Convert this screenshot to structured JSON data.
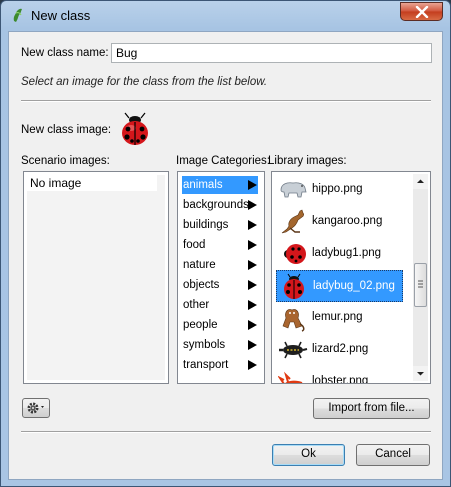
{
  "window": {
    "title": "New class"
  },
  "form": {
    "class_name_label": "New class name:",
    "class_name_value": "Bug",
    "hint": "Select an image for the class from the list below.",
    "class_image_label": "New class image:"
  },
  "scenario": {
    "label": "Scenario images:",
    "items": [
      "No image"
    ]
  },
  "categories": {
    "label": "Image Categories:",
    "selected": "animals",
    "items": [
      "animals",
      "backgrounds",
      "buildings",
      "food",
      "nature",
      "objects",
      "other",
      "people",
      "symbols",
      "transport"
    ]
  },
  "library": {
    "label": "Library images:",
    "selected": "ladybug_02.png",
    "items": [
      "hippo.png",
      "kangaroo.png",
      "ladybug1.png",
      "ladybug_02.png",
      "lemur.png",
      "lizard2.png",
      "lobster.png"
    ]
  },
  "buttons": {
    "import": "Import from file...",
    "ok": "Ok",
    "cancel": "Cancel"
  },
  "icons": {
    "title": "greenfoot-icon",
    "settings": "gear-icon",
    "close": "close-icon"
  },
  "colors": {
    "selection": "#3399ff",
    "close_button": "#c33c1d"
  }
}
